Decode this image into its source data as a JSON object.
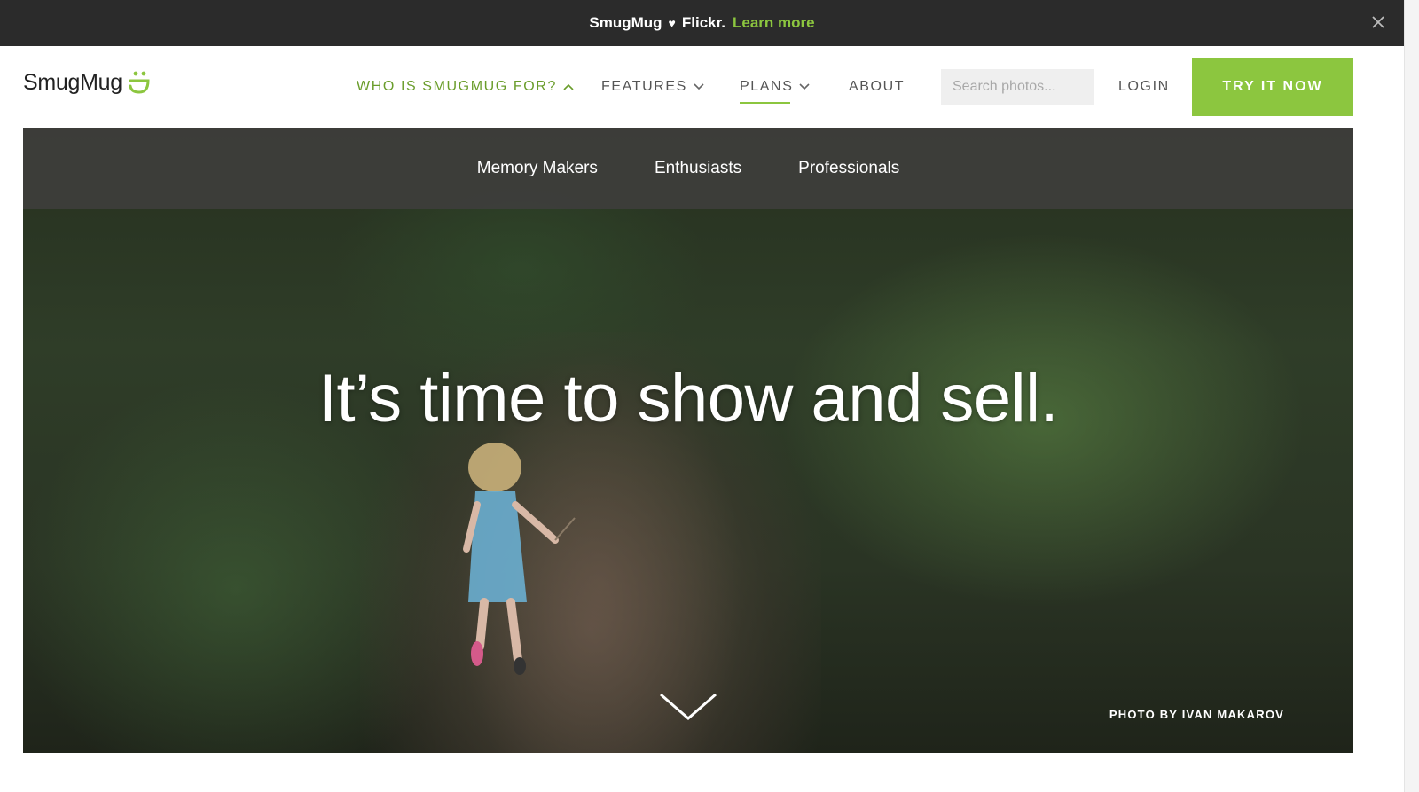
{
  "announcement": {
    "brand_a": "SmugMug",
    "heart": "♥",
    "brand_b": "Flickr.",
    "link": "Learn more"
  },
  "header": {
    "logo_text": "SmugMug",
    "nav": [
      {
        "label": "WHO IS SMUGMUG FOR?",
        "chevron": "up",
        "active": true
      },
      {
        "label": "FEATURES",
        "chevron": "down"
      },
      {
        "label": "PLANS",
        "chevron": "down",
        "underlined": true
      },
      {
        "label": "ABOUT"
      }
    ],
    "search_placeholder": "Search photos...",
    "login": "LOGIN",
    "cta": "TRY IT NOW"
  },
  "subnav": [
    "Memory Makers",
    "Enthusiasts",
    "Professionals"
  ],
  "hero": {
    "headline": "It’s time to show and sell.",
    "credit": "PHOTO BY IVAN MAKAROV"
  },
  "colors": {
    "accent": "#8cc63f",
    "topbar": "#2b2b2b",
    "subnav": "#3e3e3c"
  },
  "icons": [
    "heart-icon",
    "close-icon",
    "smugmug-logo-icon",
    "chevron-up-icon",
    "chevron-down-icon",
    "scroll-down-chevron-icon"
  ]
}
